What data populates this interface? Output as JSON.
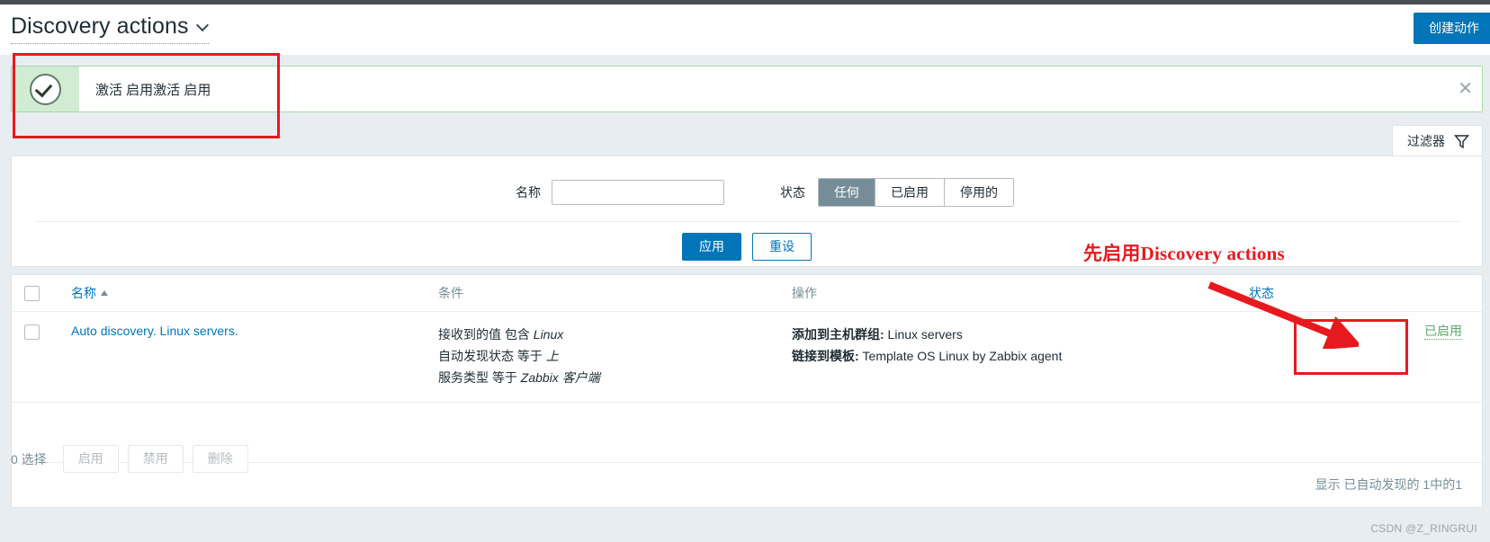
{
  "header": {
    "title": "Discovery actions",
    "chevron_icon": "chevron-down-icon",
    "create_button": "创建动作"
  },
  "message": {
    "icon": "check-circle-icon",
    "text": "激活 启用激活 启用",
    "close_icon": "close-icon"
  },
  "filter_tab": {
    "label": "过滤器",
    "icon": "funnel-icon"
  },
  "filter": {
    "name_label": "名称",
    "name_value": "",
    "name_placeholder": "",
    "status_label": "状态",
    "status_options": [
      "任何",
      "已启用",
      "停用的"
    ],
    "status_selected": "任何",
    "apply_label": "应用",
    "reset_label": "重设"
  },
  "table": {
    "columns": {
      "name": "名称",
      "conditions": "条件",
      "operations": "操作",
      "status": "状态"
    },
    "sort_indicator": "▲",
    "rows": [
      {
        "name": "Auto discovery. Linux servers.",
        "conditions": [
          {
            "prefix": "接收到的值 包含 ",
            "value": "Linux"
          },
          {
            "prefix": "自动发现状态 等于 ",
            "value": "上"
          },
          {
            "prefix": "服务类型 等于 ",
            "value": "Zabbix 客户端"
          }
        ],
        "operations": [
          {
            "label": "添加到主机群组:",
            "value": " Linux servers"
          },
          {
            "label": "链接到模板:",
            "value": " Template OS Linux by Zabbix agent"
          }
        ],
        "status": "已启用"
      }
    ],
    "footer": "显示 已自动发现的 1中的1"
  },
  "bottom_bar": {
    "selected_text": "0 选择",
    "enable_label": "启用",
    "disable_label": "禁用",
    "delete_label": "删除"
  },
  "annotations": {
    "note": "先启用Discovery actions",
    "arrow_icon": "arrow-icon",
    "box_message": "highlight-box-message",
    "box_status": "highlight-box-status"
  },
  "watermark": "CSDN @Z_RINGRUI",
  "colors": {
    "accent_blue": "#0275b8",
    "success_green": "#59a869",
    "annotation_red": "#e8191e",
    "page_bg": "#e8edf1",
    "msg_bg": "#d1ecd2"
  }
}
